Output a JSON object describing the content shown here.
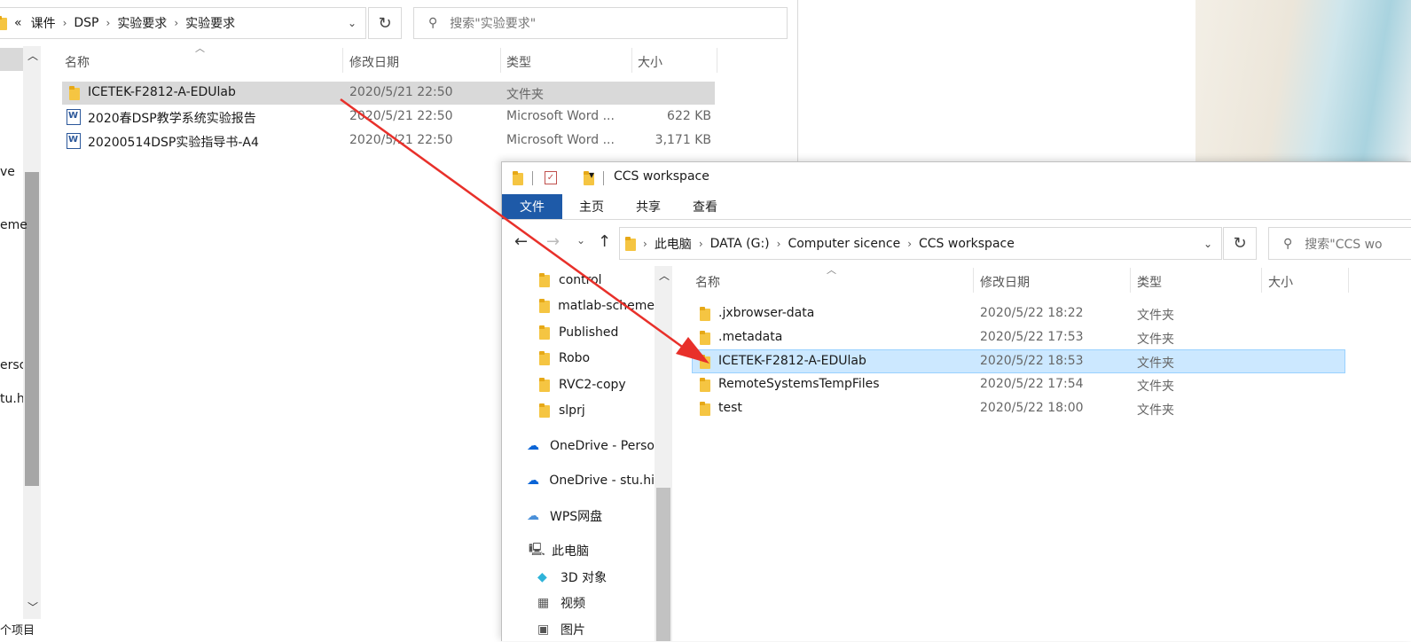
{
  "w1": {
    "breadcrumb": [
      "课件",
      "DSP",
      "实验要求",
      "实验要求"
    ],
    "search_placeholder": "搜索\"实验要求\"",
    "columns": [
      "名称",
      "修改日期",
      "类型",
      "大小"
    ],
    "rows": [
      {
        "name": "ICETEK-F2812-A-EDUlab",
        "date": "2020/5/21 22:50",
        "type": "文件夹",
        "size": ""
      },
      {
        "name": "2020春DSP教学系统实验报告",
        "date": "2020/5/21 22:50",
        "type": "Microsoft Word ...",
        "size": "622 KB"
      },
      {
        "name": "20200514DSP实验指导书-A4",
        "date": "2020/5/21 22:50",
        "type": "Microsoft Word ...",
        "size": "3,171 KB"
      }
    ],
    "left_fragments": [
      "ve",
      "eme",
      "ersc",
      "tu.hi",
      "个项目"
    ]
  },
  "w2": {
    "title": "CCS workspace",
    "tabs": [
      "文件",
      "主页",
      "共享",
      "查看"
    ],
    "breadcrumb": [
      "此电脑",
      "DATA (G:)",
      "Computer sicence",
      "CCS workspace"
    ],
    "search_placeholder": "搜索\"CCS wo",
    "nav": [
      {
        "label": "control",
        "icon": "folder-icon"
      },
      {
        "label": "matlab-scheme",
        "icon": "folder-icon"
      },
      {
        "label": "Published",
        "icon": "folder-icon"
      },
      {
        "label": "Robo",
        "icon": "folder-icon"
      },
      {
        "label": "RVC2-copy",
        "icon": "folder-icon"
      },
      {
        "label": "slprj",
        "icon": "folder-icon"
      },
      {
        "label": "OneDrive - Perso",
        "icon": "onedrive-icon"
      },
      {
        "label": "OneDrive - stu.hi",
        "icon": "onedrive-icon"
      },
      {
        "label": "WPS网盘",
        "icon": "cloud-icon"
      },
      {
        "label": "此电脑",
        "icon": "computer-icon"
      },
      {
        "label": "3D 对象",
        "icon": "cube-icon"
      },
      {
        "label": "视频",
        "icon": "video-icon"
      },
      {
        "label": "图片",
        "icon": "picture-icon"
      }
    ],
    "columns": [
      "名称",
      "修改日期",
      "类型",
      "大小"
    ],
    "rows": [
      {
        "name": ".jxbrowser-data",
        "date": "2020/5/22 18:22",
        "type": "文件夹"
      },
      {
        "name": ".metadata",
        "date": "2020/5/22 17:53",
        "type": "文件夹"
      },
      {
        "name": "ICETEK-F2812-A-EDUlab",
        "date": "2020/5/22 18:53",
        "type": "文件夹"
      },
      {
        "name": "RemoteSystemsTempFiles",
        "date": "2020/5/22 17:54",
        "type": "文件夹"
      },
      {
        "name": "test",
        "date": "2020/5/22 18:00",
        "type": "文件夹"
      }
    ]
  },
  "colors": {
    "accent": "#1e5aa8",
    "selection": "#cce8ff",
    "selection_border": "#99d1ff",
    "arrow": "#e8302a"
  }
}
